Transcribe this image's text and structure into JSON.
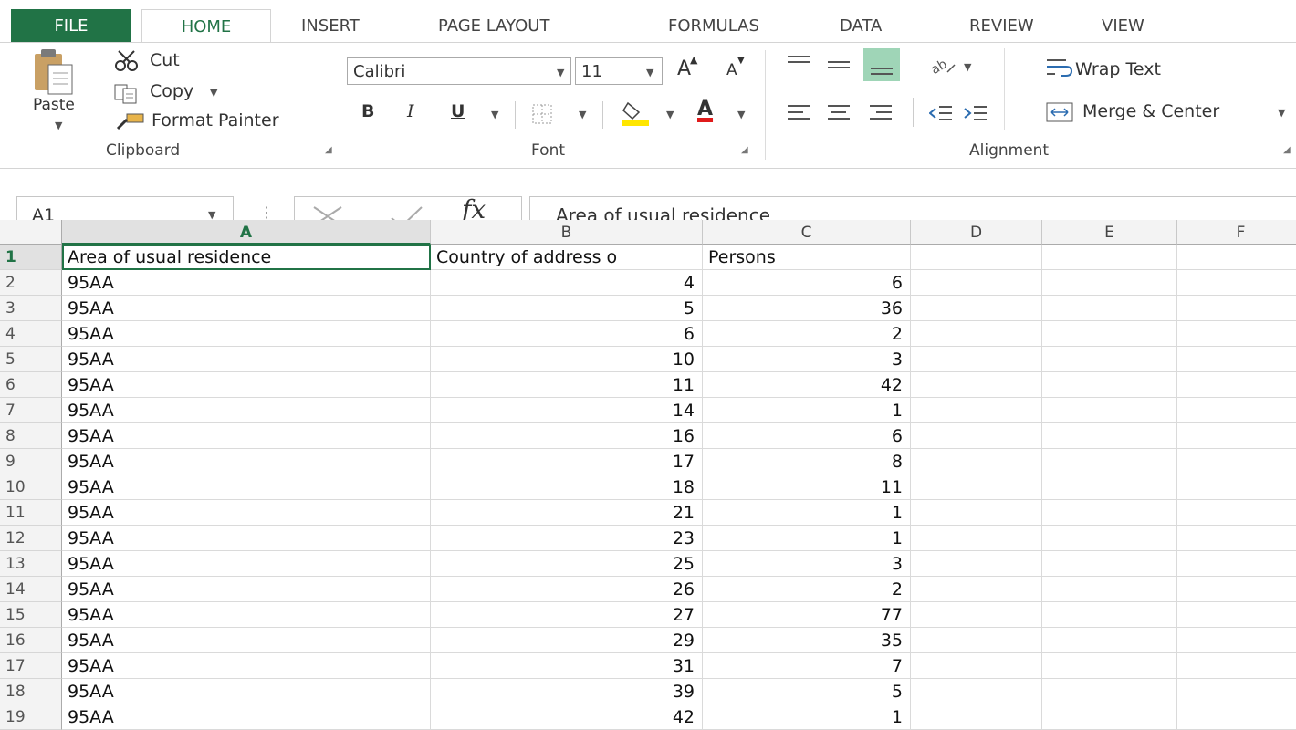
{
  "tabs": {
    "file": "FILE",
    "home": "HOME",
    "insert": "INSERT",
    "page_layout": "PAGE LAYOUT",
    "formulas": "FORMULAS",
    "data": "DATA",
    "review": "REVIEW",
    "view": "VIEW"
  },
  "clipboard": {
    "paste": "Paste",
    "cut": "Cut",
    "copy": "Copy",
    "format_painter": "Format Painter",
    "label": "Clipboard"
  },
  "font": {
    "family": "Calibri",
    "size": "11",
    "label": "Font",
    "bold": "B",
    "italic": "I",
    "underline": "U",
    "grow": "A",
    "shrink": "A",
    "font_color": "A"
  },
  "alignment": {
    "wrap_text": "Wrap Text",
    "merge_center": "Merge & Center",
    "label": "Alignment"
  },
  "formula_bar": {
    "name_box": "A1",
    "fx": "fx",
    "content": "Area of usual residence"
  },
  "colors": {
    "excel_green": "#217346",
    "font_color_bar": "#e01b1b",
    "fill_color_bar": "#ffe600"
  },
  "columns": [
    "A",
    "B",
    "C",
    "D",
    "E",
    "F"
  ],
  "rows": [
    {
      "n": "1",
      "a": "Area of usual residence",
      "b": "Country of address o",
      "c": "Persons"
    },
    {
      "n": "2",
      "a": "95AA",
      "b": "4",
      "c": "6"
    },
    {
      "n": "3",
      "a": "95AA",
      "b": "5",
      "c": "36"
    },
    {
      "n": "4",
      "a": "95AA",
      "b": "6",
      "c": "2"
    },
    {
      "n": "5",
      "a": "95AA",
      "b": "10",
      "c": "3"
    },
    {
      "n": "6",
      "a": "95AA",
      "b": "11",
      "c": "42"
    },
    {
      "n": "7",
      "a": "95AA",
      "b": "14",
      "c": "1"
    },
    {
      "n": "8",
      "a": "95AA",
      "b": "16",
      "c": "6"
    },
    {
      "n": "9",
      "a": "95AA",
      "b": "17",
      "c": "8"
    },
    {
      "n": "10",
      "a": "95AA",
      "b": "18",
      "c": "11"
    },
    {
      "n": "11",
      "a": "95AA",
      "b": "21",
      "c": "1"
    },
    {
      "n": "12",
      "a": "95AA",
      "b": "23",
      "c": "1"
    },
    {
      "n": "13",
      "a": "95AA",
      "b": "25",
      "c": "3"
    },
    {
      "n": "14",
      "a": "95AA",
      "b": "26",
      "c": "2"
    },
    {
      "n": "15",
      "a": "95AA",
      "b": "27",
      "c": "77"
    },
    {
      "n": "16",
      "a": "95AA",
      "b": "29",
      "c": "35"
    },
    {
      "n": "17",
      "a": "95AA",
      "b": "31",
      "c": "7"
    },
    {
      "n": "18",
      "a": "95AA",
      "b": "39",
      "c": "5"
    },
    {
      "n": "19",
      "a": "95AA",
      "b": "42",
      "c": "1"
    }
  ]
}
